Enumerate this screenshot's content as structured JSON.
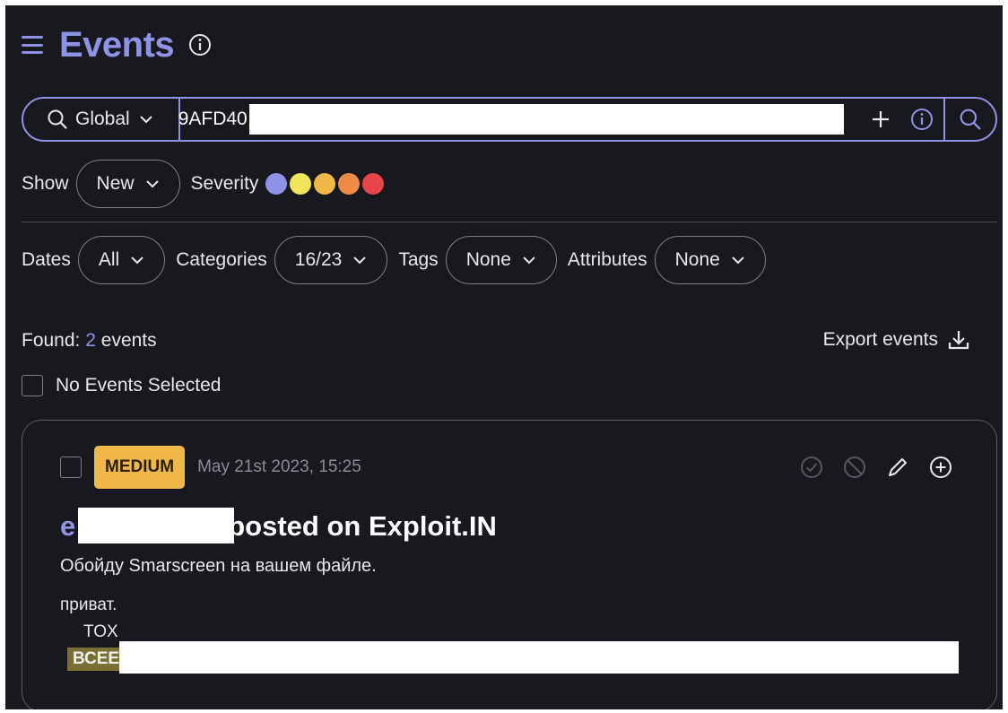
{
  "header": {
    "title": "Events"
  },
  "search": {
    "scope": "Global",
    "query": "9AFD40"
  },
  "filters_row1": {
    "show_label": "Show",
    "show_value": "New",
    "severity_label": "Severity",
    "severity_colors": [
      "#8f93e8",
      "#efe45a",
      "#f0b848",
      "#ee8c45",
      "#e8454a"
    ]
  },
  "filters_row2": {
    "dates_label": "Dates",
    "dates_value": "All",
    "categories_label": "Categories",
    "categories_value": "16/23",
    "tags_label": "Tags",
    "tags_value": "None",
    "attributes_label": "Attributes",
    "attributes_value": "None"
  },
  "results": {
    "found_label": "Found:",
    "found_count": "2",
    "found_suffix": "events",
    "export_label": "Export events",
    "selection_label": "No Events Selected"
  },
  "event": {
    "severity": "MEDIUM",
    "severity_color": "#f0b848",
    "timestamp": "May 21st 2023, 15:25",
    "author_visible": "e",
    "title_rest": "posted on Exploit.IN",
    "summary": "Обойду Smarscreen на вашем файле.",
    "body_line1": "приват.",
    "body_line2": "TOX",
    "body_highlight": "ВСЕЕ"
  },
  "accent_color": "#8f93e8"
}
